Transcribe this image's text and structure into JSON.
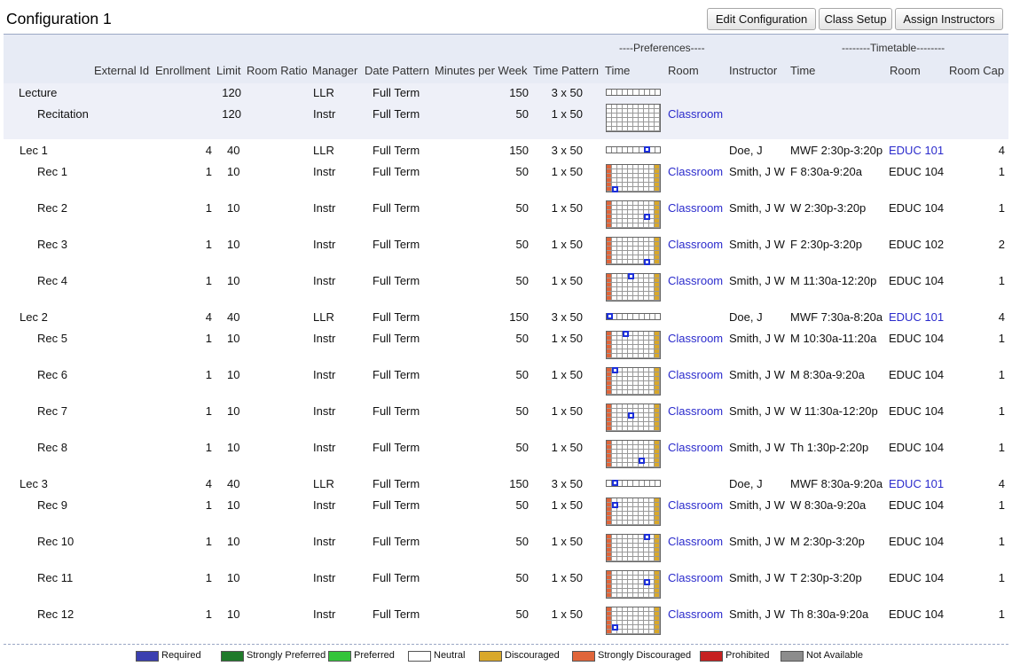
{
  "title": "Configuration 1",
  "buttons": {
    "edit": "Edit Configuration",
    "setup": "Class Setup",
    "assign": "Assign Instructors"
  },
  "groups": {
    "preferences": "----Preferences----",
    "timetable": "--------Timetable--------"
  },
  "columns": {
    "external_id": "External Id",
    "enrollment": "Enrollment",
    "limit": "Limit",
    "room_ratio": "Room Ratio",
    "manager": "Manager",
    "date_pattern": "Date Pattern",
    "minutes": "Minutes per Week",
    "time_pattern": "Time Pattern",
    "pref_time": "Time",
    "pref_room": "Room",
    "instructor": "Instructor",
    "tt_time": "Time",
    "tt_room": "Room",
    "room_cap": "Room Cap"
  },
  "subparts": [
    {
      "name": "Lecture",
      "limit": "120",
      "manager": "LLR",
      "date_pattern": "Full Term",
      "minutes": "150",
      "time_pattern": "3 x 50",
      "pref_room": ""
    },
    {
      "name": "Recitation",
      "limit": "120",
      "manager": "Instr",
      "date_pattern": "Full Term",
      "minutes": "50",
      "time_pattern": "1 x 50",
      "pref_room": "Classroom"
    }
  ],
  "classes": [
    {
      "name": "Lec 1",
      "enrollment": "4",
      "limit": "40",
      "manager": "LLR",
      "date_pattern": "Full Term",
      "minutes": "150",
      "time_pattern": "3 x 50",
      "pref_room": "",
      "instructor": "Doe, J",
      "time": "MWF 2:30p-3:20p",
      "room": "EDUC 101",
      "room_cap": "4"
    },
    {
      "name": "Rec 1",
      "enrollment": "1",
      "limit": "10",
      "manager": "Instr",
      "date_pattern": "Full Term",
      "minutes": "50",
      "time_pattern": "1 x 50",
      "pref_room": "Classroom",
      "instructor": "Smith, J W",
      "time": "F 8:30a-9:20a",
      "room": "EDUC 104",
      "room_cap": "1"
    },
    {
      "name": "Rec 2",
      "enrollment": "1",
      "limit": "10",
      "manager": "Instr",
      "date_pattern": "Full Term",
      "minutes": "50",
      "time_pattern": "1 x 50",
      "pref_room": "Classroom",
      "instructor": "Smith, J W",
      "time": "W 2:30p-3:20p",
      "room": "EDUC 104",
      "room_cap": "1"
    },
    {
      "name": "Rec 3",
      "enrollment": "1",
      "limit": "10",
      "manager": "Instr",
      "date_pattern": "Full Term",
      "minutes": "50",
      "time_pattern": "1 x 50",
      "pref_room": "Classroom",
      "instructor": "Smith, J W",
      "time": "F 2:30p-3:20p",
      "room": "EDUC 102",
      "room_cap": "2"
    },
    {
      "name": "Rec 4",
      "enrollment": "1",
      "limit": "10",
      "manager": "Instr",
      "date_pattern": "Full Term",
      "minutes": "50",
      "time_pattern": "1 x 50",
      "pref_room": "Classroom",
      "instructor": "Smith, J W",
      "time": "M 11:30a-12:20p",
      "room": "EDUC 104",
      "room_cap": "1"
    },
    {
      "name": "Lec 2",
      "enrollment": "4",
      "limit": "40",
      "manager": "LLR",
      "date_pattern": "Full Term",
      "minutes": "150",
      "time_pattern": "3 x 50",
      "pref_room": "",
      "instructor": "Doe, J",
      "time": "MWF 7:30a-8:20a",
      "room": "EDUC 101",
      "room_cap": "4"
    },
    {
      "name": "Rec 5",
      "enrollment": "1",
      "limit": "10",
      "manager": "Instr",
      "date_pattern": "Full Term",
      "minutes": "50",
      "time_pattern": "1 x 50",
      "pref_room": "Classroom",
      "instructor": "Smith, J W",
      "time": "M 10:30a-11:20a",
      "room": "EDUC 104",
      "room_cap": "1"
    },
    {
      "name": "Rec 6",
      "enrollment": "1",
      "limit": "10",
      "manager": "Instr",
      "date_pattern": "Full Term",
      "minutes": "50",
      "time_pattern": "1 x 50",
      "pref_room": "Classroom",
      "instructor": "Smith, J W",
      "time": "M 8:30a-9:20a",
      "room": "EDUC 104",
      "room_cap": "1"
    },
    {
      "name": "Rec 7",
      "enrollment": "1",
      "limit": "10",
      "manager": "Instr",
      "date_pattern": "Full Term",
      "minutes": "50",
      "time_pattern": "1 x 50",
      "pref_room": "Classroom",
      "instructor": "Smith, J W",
      "time": "W 11:30a-12:20p",
      "room": "EDUC 104",
      "room_cap": "1"
    },
    {
      "name": "Rec 8",
      "enrollment": "1",
      "limit": "10",
      "manager": "Instr",
      "date_pattern": "Full Term",
      "minutes": "50",
      "time_pattern": "1 x 50",
      "pref_room": "Classroom",
      "instructor": "Smith, J W",
      "time": "Th 1:30p-2:20p",
      "room": "EDUC 104",
      "room_cap": "1"
    },
    {
      "name": "Lec 3",
      "enrollment": "4",
      "limit": "40",
      "manager": "LLR",
      "date_pattern": "Full Term",
      "minutes": "150",
      "time_pattern": "3 x 50",
      "pref_room": "",
      "instructor": "Doe, J",
      "time": "MWF 8:30a-9:20a",
      "room": "EDUC 101",
      "room_cap": "4"
    },
    {
      "name": "Rec 9",
      "enrollment": "1",
      "limit": "10",
      "manager": "Instr",
      "date_pattern": "Full Term",
      "minutes": "50",
      "time_pattern": "1 x 50",
      "pref_room": "Classroom",
      "instructor": "Smith, J W",
      "time": "W 8:30a-9:20a",
      "room": "EDUC 104",
      "room_cap": "1"
    },
    {
      "name": "Rec 10",
      "enrollment": "1",
      "limit": "10",
      "manager": "Instr",
      "date_pattern": "Full Term",
      "minutes": "50",
      "time_pattern": "1 x 50",
      "pref_room": "Classroom",
      "instructor": "Smith, J W",
      "time": "M 2:30p-3:20p",
      "room": "EDUC 104",
      "room_cap": "1"
    },
    {
      "name": "Rec 11",
      "enrollment": "1",
      "limit": "10",
      "manager": "Instr",
      "date_pattern": "Full Term",
      "minutes": "50",
      "time_pattern": "1 x 50",
      "pref_room": "Classroom",
      "instructor": "Smith, J W",
      "time": "T 2:30p-3:20p",
      "room": "EDUC 104",
      "room_cap": "1"
    },
    {
      "name": "Rec 12",
      "enrollment": "1",
      "limit": "10",
      "manager": "Instr",
      "date_pattern": "Full Term",
      "minutes": "50",
      "time_pattern": "1 x 50",
      "pref_room": "Classroom",
      "instructor": "Smith, J W",
      "time": "Th 8:30a-9:20a",
      "room": "EDUC 104",
      "room_cap": "1"
    }
  ],
  "legend": [
    {
      "label": "Required",
      "color": "#3b3fb0"
    },
    {
      "label": "Strongly Preferred",
      "color": "#1f7a2a"
    },
    {
      "label": "Preferred",
      "color": "#33c43a"
    },
    {
      "label": "Neutral",
      "color": "#ffffff"
    },
    {
      "label": "Discouraged",
      "color": "#d9a82a"
    },
    {
      "label": "Strongly Discouraged",
      "color": "#e0653a"
    },
    {
      "label": "Prohibited",
      "color": "#c62020"
    },
    {
      "label": "Not Available",
      "color": "#8c8c8c"
    }
  ],
  "colors": {
    "link": "#2b2bcc",
    "discouraged": "#d9a82a",
    "strongly_discouraged": "#e0653a",
    "selected": "#1c2fd9"
  }
}
